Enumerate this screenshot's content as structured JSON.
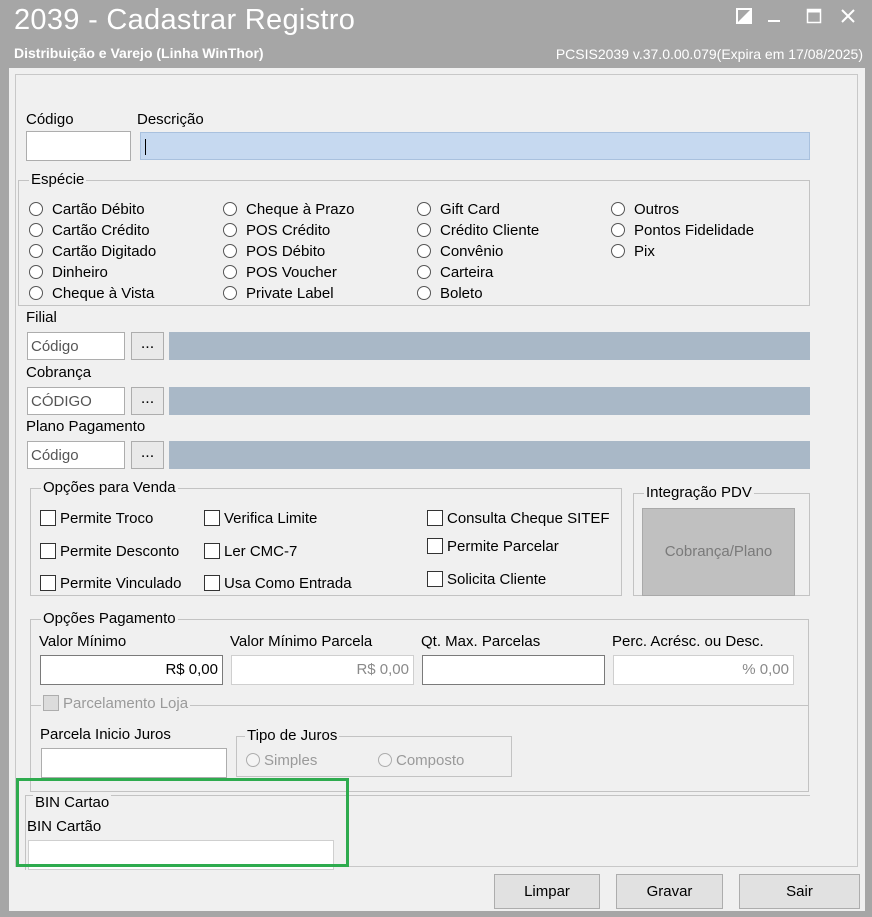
{
  "window": {
    "title": "2039 - Cadastrar Registro",
    "subtitle": "Distribuição e Varejo (Linha WinThor)",
    "version": "PCSIS2039  v.37.0.00.079(Expira em 17/08/2025)"
  },
  "form": {
    "codigo_label": "Código",
    "descricao_label": "Descrição",
    "codigo_value": "",
    "descricao_value": ""
  },
  "especie": {
    "title": "Espécie",
    "options": [
      "Cartão Débito",
      "Cartão Crédito",
      "Cartão Digitado",
      "Dinheiro",
      "Cheque à Vista",
      "Cheque à Prazo",
      "POS Crédito",
      "POS Débito",
      "POS Voucher",
      "Private Label",
      "Gift Card",
      "Crédito Cliente",
      "Convênio",
      "Carteira",
      "Boleto",
      "Outros",
      "Pontos Fidelidade",
      "Pix"
    ]
  },
  "filial": {
    "label": "Filial",
    "placeholder": "Código",
    "button": "..."
  },
  "cobranca": {
    "label": "Cobrança",
    "placeholder": "CÓDIGO",
    "button": "..."
  },
  "plano": {
    "label": "Plano Pagamento",
    "placeholder": "Código",
    "button": "..."
  },
  "opcoes_venda": {
    "title": "Opções para Venda",
    "items": [
      "Permite Troco",
      "Permite Desconto",
      "Permite Vinculado",
      "Verifica Limite",
      "Ler CMC-7",
      "Usa Como Entrada",
      "Consulta Cheque SITEF",
      "Permite Parcelar",
      "Solicita Cliente"
    ]
  },
  "integracao": {
    "title": "Integração PDV",
    "button": "Cobrança/Plano"
  },
  "opcoes_pagamento": {
    "title": "Opções Pagamento",
    "valor_minimo_label": "Valor Mínimo",
    "valor_minimo_value": "R$ 0,00",
    "valor_min_parcela_label": "Valor Mínimo Parcela",
    "valor_min_parcela_value": "R$ 0,00",
    "qt_max_parcelas_label": "Qt. Max. Parcelas",
    "qt_max_parcelas_value": "",
    "perc_label": "Perc. Acrésc. ou Desc.",
    "perc_value": "% 0,00",
    "parcelamento_loja": "Parcelamento Loja",
    "parcela_inicio_juros_label": "Parcela Inicio Juros",
    "tipo_juros_title": "Tipo de Juros",
    "tipo_juros_options": [
      "Simples",
      "Composto"
    ]
  },
  "bin": {
    "title": "BIN Cartao",
    "label": "BIN Cartão",
    "value": ""
  },
  "buttons": {
    "limpar": "Limpar",
    "gravar": "Gravar",
    "sair": "Sair"
  },
  "colors": {
    "titlebar": "#a6a6a6",
    "highlight": "#2eab4e",
    "lookup_fill": "#a9b8c7",
    "focus_fill": "#c6d9f0"
  }
}
